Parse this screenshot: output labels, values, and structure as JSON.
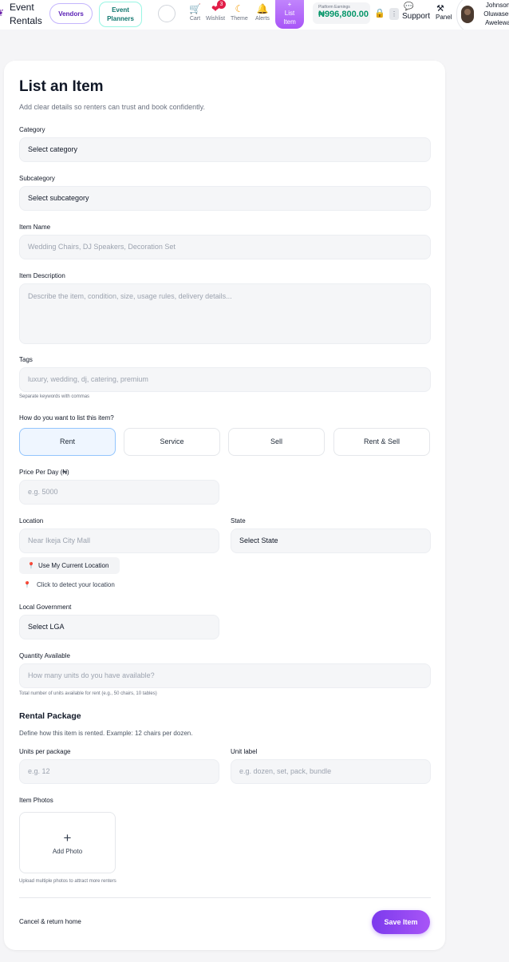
{
  "header": {
    "brand_line1": "Event",
    "brand_line2": "Rentals",
    "vendors_label": "Vendors",
    "planners_line1": "Event",
    "planners_line2": "Planners",
    "nav": {
      "cart": "Cart",
      "wishlist": "Wishlist",
      "wishlist_count": "3",
      "theme": "Theme",
      "alerts": "Alerts"
    },
    "list_item_line1": "List",
    "list_item_line2": "Item",
    "earnings_label": "Platform Earnings",
    "earnings_value": "₦996,800.00",
    "support_label": "Support",
    "panel_label": "Panel",
    "profile_line1": "Johnson",
    "profile_line2": "Oluwaseu",
    "profile_line3": "Awelewa"
  },
  "form": {
    "title": "List an Item",
    "subtitle": "Add clear details so renters can trust and book confidently.",
    "category_label": "Category",
    "category_value": "Select category",
    "subcategory_label": "Subcategory",
    "subcategory_value": "Select subcategory",
    "item_name_label": "Item Name",
    "item_name_placeholder": "Wedding Chairs, DJ Speakers, Decoration Set",
    "description_label": "Item Description",
    "description_placeholder": "Describe the item, condition, size, usage rules, delivery details...",
    "tags_label": "Tags",
    "tags_placeholder": "luxury, wedding, dj, catering, premium",
    "tags_hint": "Separate keywords with commas",
    "listing_question": "How do you want to list this item?",
    "listing_options": [
      "Rent",
      "Service",
      "Sell",
      "Rent & Sell"
    ],
    "listing_selected": "Rent",
    "price_label": "Price Per Day (₦)",
    "price_placeholder": "e.g. 5000",
    "location_label": "Location",
    "location_placeholder": "Near Ikeja City Mall",
    "state_label": "State",
    "state_value": "Select State",
    "use_location_label": "Use My Current Location",
    "detect_hint": "Click to detect your location",
    "lga_label": "Local Government",
    "lga_value": "Select LGA",
    "quantity_label": "Quantity Available",
    "quantity_placeholder": "How many units do you have available?",
    "quantity_hint": "Total number of units available for rent (e.g., 50 chairs, 10 tables)",
    "package_heading": "Rental Package",
    "package_desc": "Define how this item is rented. Example: 12 chairs per dozen.",
    "units_label": "Units per package",
    "units_placeholder": "e.g. 12",
    "unit_label_label": "Unit label",
    "unit_label_placeholder": "e.g. dozen, set, pack, bundle",
    "photos_label": "Item Photos",
    "add_photo_label": "Add Photo",
    "photos_hint": "Upload multiple photos to attract more renters",
    "cancel_label": "Cancel & return home",
    "save_label": "Save Item"
  },
  "colors": {
    "accent": "#7c3aed",
    "earnings": "#059669",
    "selected_option_bg": "#eff6ff"
  }
}
